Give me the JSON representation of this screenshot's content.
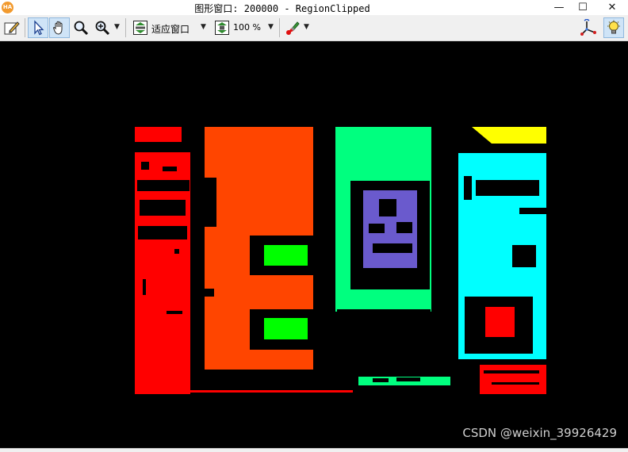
{
  "window": {
    "app_icon_text": "HA",
    "title": "图形窗口: 200000 - RegionClipped",
    "minimize": "—",
    "maximize": "☐",
    "close": "✕"
  },
  "toolbar": {
    "edit_icon": "edit-icon",
    "pointer_icon": "pointer-icon",
    "hand_icon": "hand-pan-icon",
    "magnifier_icon": "magnifier-icon",
    "zoom_in_icon": "zoom-in-icon",
    "fit_icon": "fit-window-icon",
    "fit_label": "适应窗口",
    "zoom_percent_icon": "zoom-percent-icon",
    "zoom_label": "100 %",
    "paint_icon": "paint-icon",
    "axes_icon": "axes-icon",
    "bulb_icon": "lightbulb-icon",
    "dropdown_glyph": "▼"
  },
  "colors": {
    "red": "#ff0000",
    "orange": "#ff4500",
    "spring_green": "#00ff7f",
    "green": "#00ff00",
    "slate_blue": "#6a5acd",
    "cyan": "#00ffff",
    "yellow": "#ffff00",
    "black": "#000000"
  },
  "watermark": "CSDN @weixin_39926429"
}
